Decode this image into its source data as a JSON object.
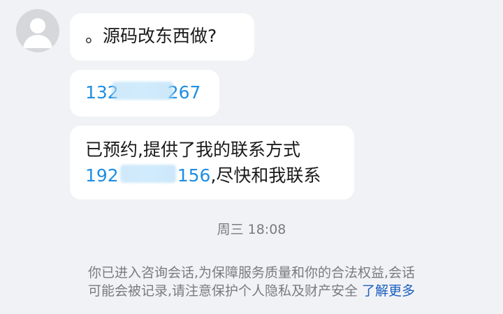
{
  "chat": {
    "avatar_icon": "person-icon",
    "messages": [
      {
        "text": "。源码改东西做?"
      },
      {
        "phone_prefix": "132",
        "phone_suffix": "267"
      },
      {
        "line1": "已预约,提供了我的联系方式",
        "phone_prefix": "192",
        "phone_suffix": "156",
        "after_phone": ",尽快和我联系"
      }
    ],
    "timestamp": "周三 18:08"
  },
  "notice": {
    "line1": "你已进入咨询会话,为保障服务质量和你的合法权益,会话",
    "line2": "可能会被记录,请注意保护个人隐私及财产安全",
    "link_label": "了解更多"
  },
  "colors": {
    "background": "#f1f2f5",
    "bubble": "#ffffff",
    "phone_link": "#1f8ee3",
    "notice_link": "#1a5fbf"
  }
}
